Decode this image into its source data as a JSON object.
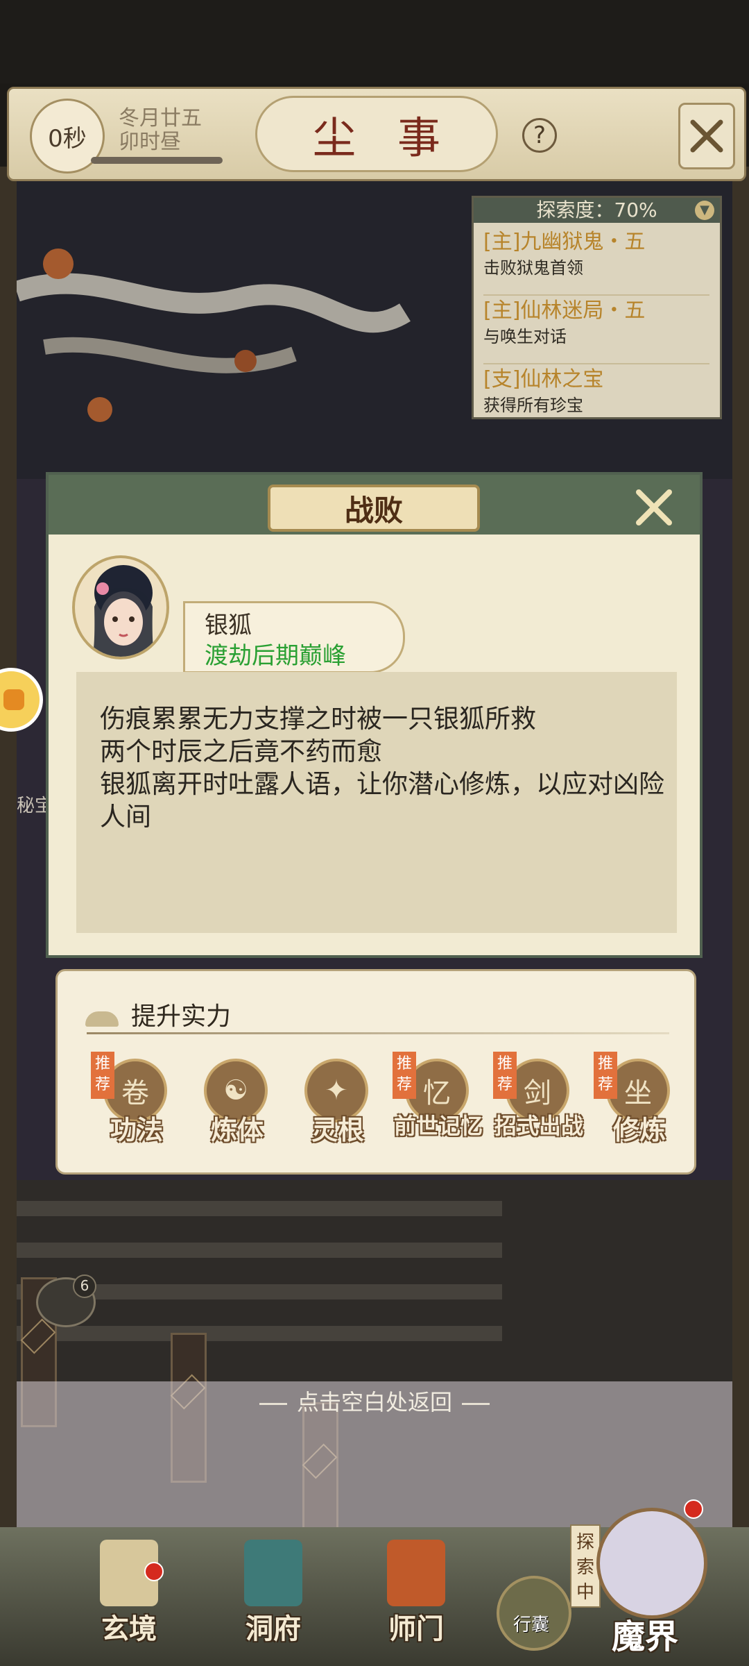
{
  "header": {
    "timer": "0秒",
    "date_line1": "冬月廿五",
    "date_line2": "卯时昼",
    "title": "尘事"
  },
  "quest_panel": {
    "progress_label": "探索度：70%",
    "quests": [
      {
        "title": "[主]九幽狱鬼・五",
        "desc": "击败狱鬼首领"
      },
      {
        "title": "[主]仙林迷局・五",
        "desc": "与唤生对话"
      },
      {
        "title": "[支]仙林之宝",
        "desc": "获得所有珍宝"
      }
    ]
  },
  "side": {
    "partial_text": "秘宝",
    "chat_count": "6"
  },
  "dialog": {
    "title": "战败",
    "npc_name": "银狐",
    "npc_realm": "渡劫后期巅峰",
    "story_lines": [
      "伤痕累累无力支撑之时被一只银狐所救",
      "两个时辰之后竟不药而愈",
      "银狐离开时吐露人语，让你潜心修炼，以应对凶险人间"
    ]
  },
  "improve_power": {
    "header": "提升实力",
    "badge_text": "推荐",
    "items": [
      {
        "label": "功法",
        "recommended": true,
        "icon": "scroll-icon"
      },
      {
        "label": "炼体",
        "recommended": false,
        "icon": "body-training-icon"
      },
      {
        "label": "灵根",
        "recommended": false,
        "icon": "spirit-root-icon"
      },
      {
        "label": "前世记忆",
        "recommended": true,
        "icon": "memory-icon"
      },
      {
        "label": "招式出战",
        "recommended": true,
        "icon": "skill-icon"
      },
      {
        "label": "修炼",
        "recommended": true,
        "icon": "meditation-icon"
      }
    ]
  },
  "return_hint": "点击空白处返回",
  "bottom_nav": {
    "items": [
      {
        "label": "玄境"
      },
      {
        "label": "洞府"
      },
      {
        "label": "师门"
      }
    ],
    "bag_label": "行囊",
    "explore_tag": "探索中",
    "mojie_label": "魔界"
  },
  "colors": {
    "accent_green": "#2aa033",
    "quest_gold": "#b7842b",
    "title_red": "#7a2a1c",
    "dialog_border": "#516150",
    "badge_orange": "#e2713c"
  }
}
